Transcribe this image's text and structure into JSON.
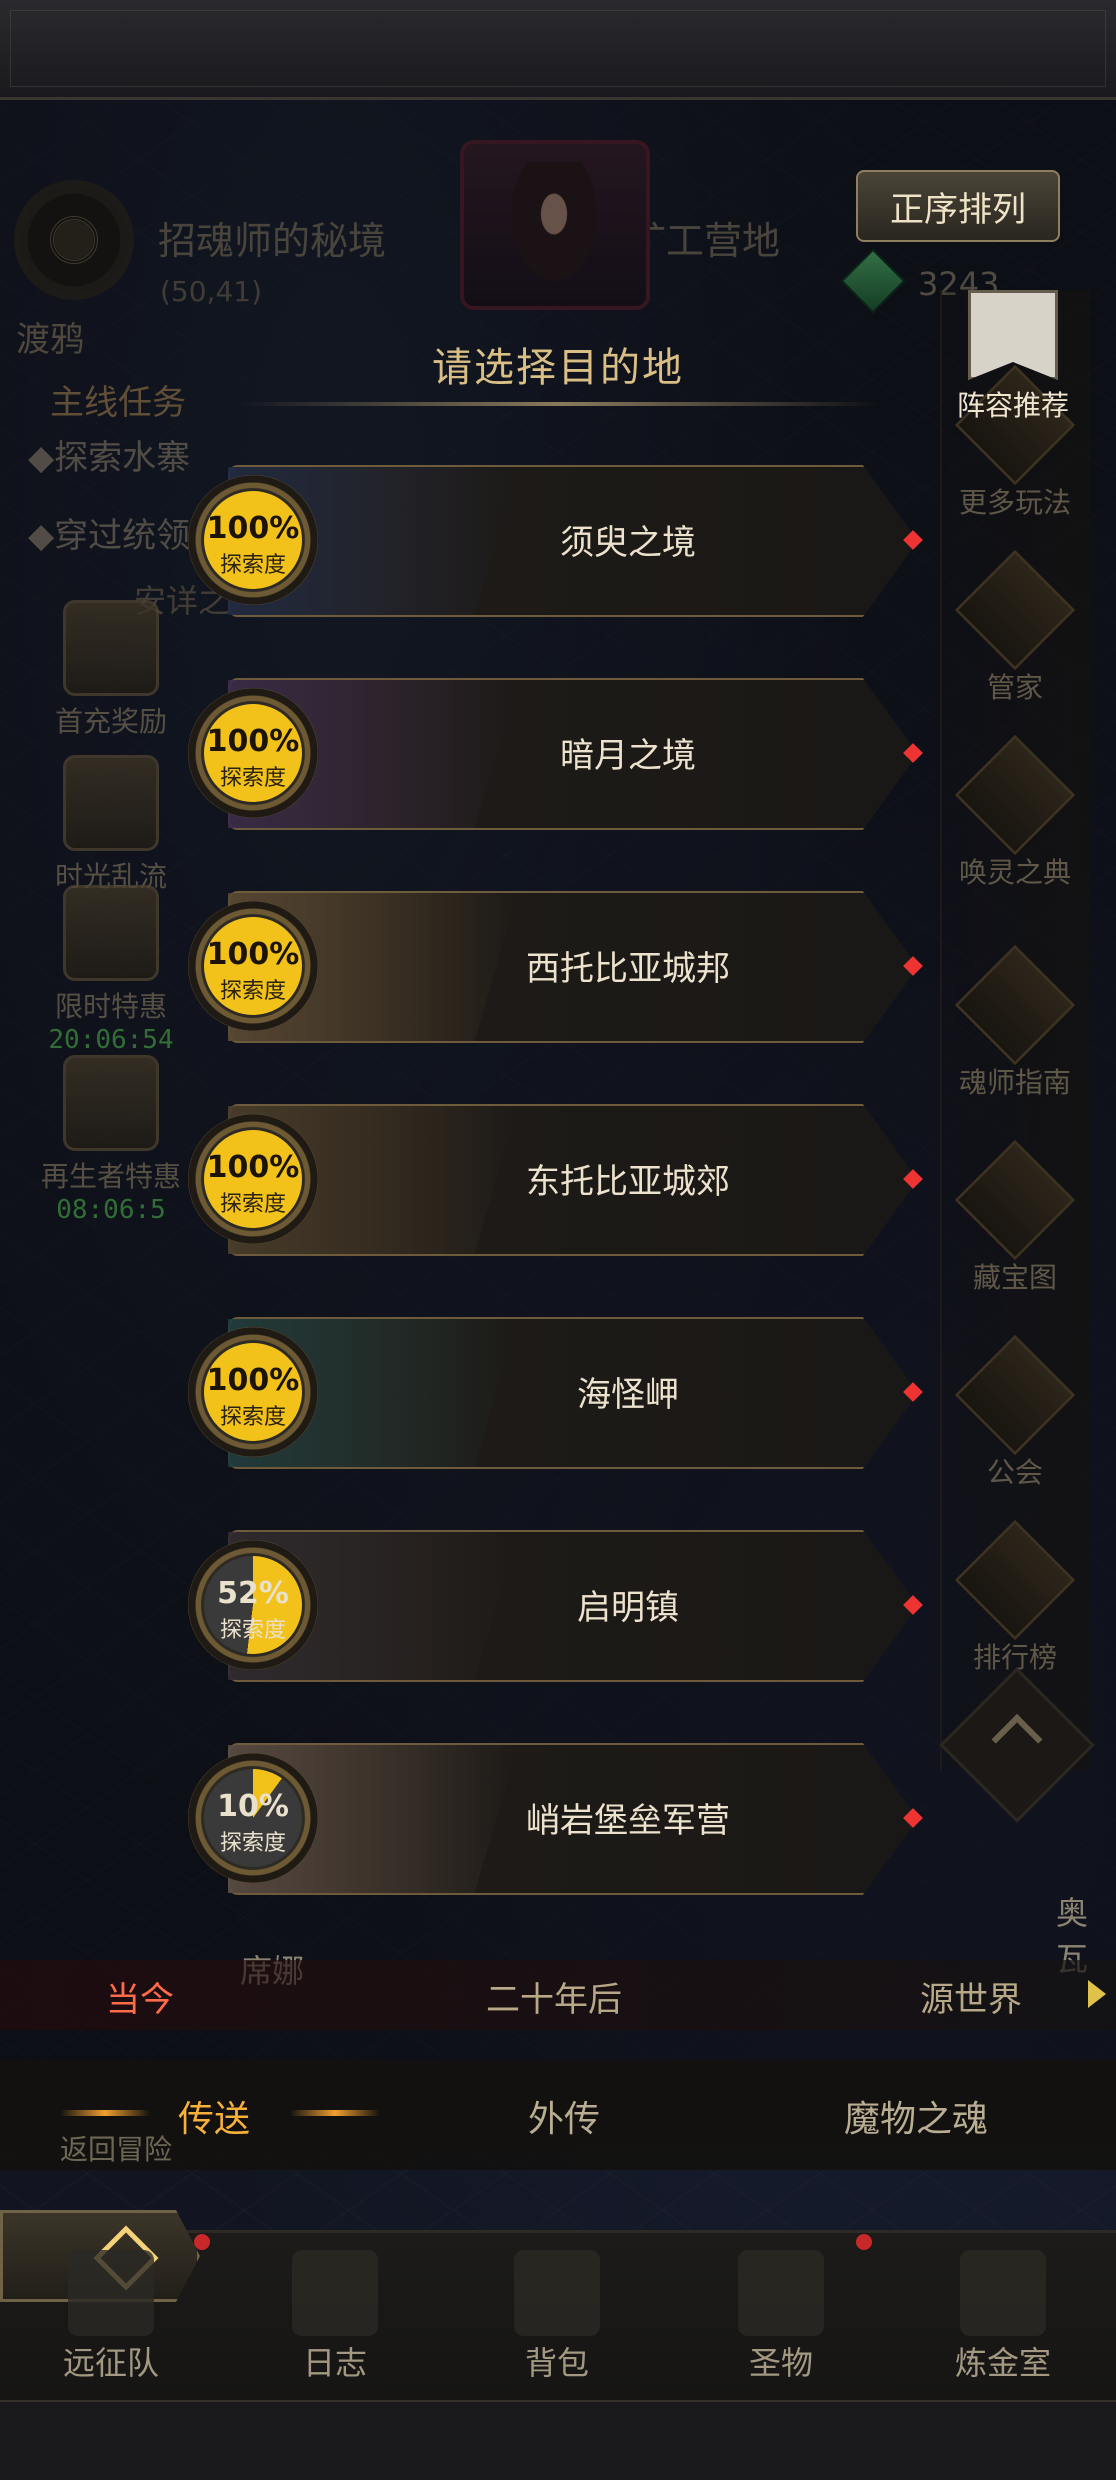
{
  "header": {
    "location_name": "招魂师的秘境",
    "coordinates": "(50,41)",
    "sub_location": "渡鸦",
    "camp_label": "矿工营地",
    "gem_value": "3243",
    "sort_button": "正序排列"
  },
  "quests": {
    "title": "主线任务",
    "items": [
      "探索水寨",
      "穿过统领"
    ],
    "peace_label": "安详之"
  },
  "left_buttons": [
    {
      "label": "首充奖励",
      "timer": ""
    },
    {
      "label": "时光乱流",
      "timer": ""
    },
    {
      "label": "限时特惠",
      "timer": "20:06:54"
    },
    {
      "label": "再生者特惠",
      "timer": "08:06:5"
    }
  ],
  "right_buttons": {
    "lineup": "阵容推荐",
    "items": [
      "更多玩法",
      "管家",
      "唤灵之典",
      "魂师指南",
      "藏宝图",
      "公会",
      "排行榜"
    ]
  },
  "panel": {
    "title": "请选择目的地",
    "progress_label": "探索度",
    "destinations": [
      {
        "name": "须臾之境",
        "progress": "100%",
        "fraction": 1.0,
        "art_color": "#1f2a44"
      },
      {
        "name": "暗月之境",
        "progress": "100%",
        "fraction": 1.0,
        "art_color": "#3a2b4a"
      },
      {
        "name": "西托比亚城邦",
        "progress": "100%",
        "fraction": 1.0,
        "art_color": "#5a4a34"
      },
      {
        "name": "东托比亚城郊",
        "progress": "100%",
        "fraction": 1.0,
        "art_color": "#4a3d2b"
      },
      {
        "name": "海怪岬",
        "progress": "100%",
        "fraction": 1.0,
        "art_color": "#1f3d3e"
      },
      {
        "name": "启明镇",
        "progress": "52%",
        "fraction": 0.52,
        "art_color": "#2e2a30"
      },
      {
        "name": "峭岩堡垒军营",
        "progress": "10%",
        "fraction": 0.1,
        "art_color": "#5a4c44"
      }
    ]
  },
  "era_tabs": [
    "当今",
    "二十年后",
    "源世界"
  ],
  "mode_tabs": [
    "传送",
    "外传",
    "魔物之魂"
  ],
  "misc_labels": {
    "return": "返回冒险",
    "nurse": "席娜",
    "ao": "奥瓦"
  },
  "bottom_nav": [
    "远征队",
    "日志",
    "背包",
    "圣物",
    "炼金室"
  ],
  "colors": {
    "progress_fill": "#f2c21a",
    "progress_empty": "#3a3a3a",
    "accent": "#f7b03a",
    "alert": "#c8282a"
  }
}
